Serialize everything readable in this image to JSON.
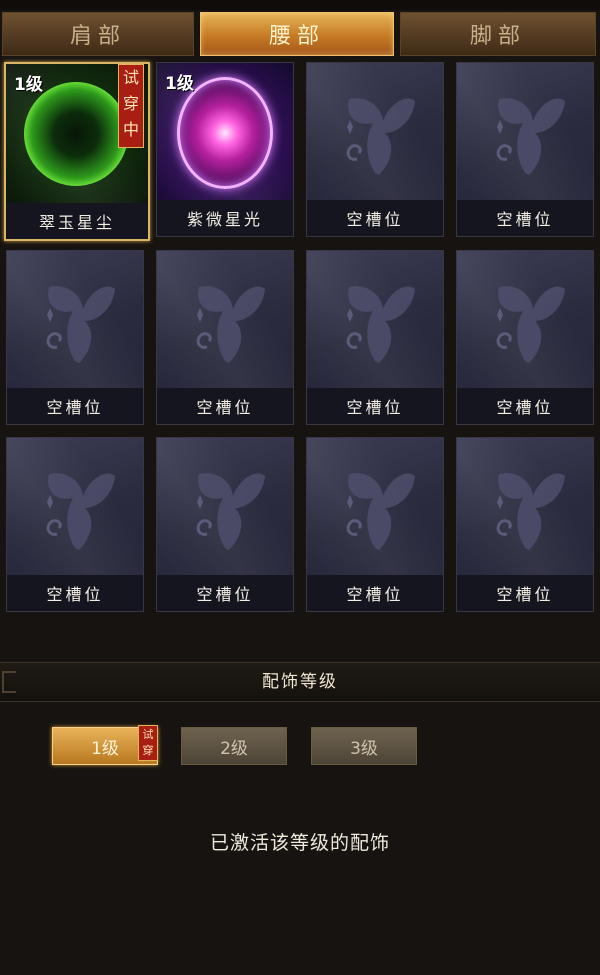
{
  "tabs": [
    {
      "label": "肩部",
      "active": false
    },
    {
      "label": "腰部",
      "active": true
    },
    {
      "label": "脚部",
      "active": false
    }
  ],
  "slots": [
    {
      "name": "翠玉星尘",
      "level": "1级",
      "trial": "试穿中",
      "icon": "green-orb-icon"
    },
    {
      "name": "紫微星光",
      "level": "1级",
      "icon": "purple-orb-icon"
    },
    {
      "name": "空槽位",
      "icon": "butterfly-icon"
    },
    {
      "name": "空槽位",
      "icon": "butterfly-icon"
    },
    {
      "name": "空槽位",
      "icon": "butterfly-icon"
    },
    {
      "name": "空槽位",
      "icon": "butterfly-icon"
    },
    {
      "name": "空槽位",
      "icon": "butterfly-icon"
    },
    {
      "name": "空槽位",
      "icon": "butterfly-icon"
    },
    {
      "name": "空槽位",
      "icon": "butterfly-icon"
    },
    {
      "name": "空槽位",
      "icon": "butterfly-icon"
    },
    {
      "name": "空槽位",
      "icon": "butterfly-icon"
    },
    {
      "name": "空槽位",
      "icon": "butterfly-icon"
    }
  ],
  "level_section": {
    "title": "配饰等级",
    "levels": [
      {
        "label": "1级",
        "active": true,
        "trial": "试穿"
      },
      {
        "label": "2级",
        "active": false
      },
      {
        "label": "3级",
        "active": false
      }
    ],
    "status": "已激活该等级的配饰"
  },
  "colors": {
    "accent_gold": "#e9b35a",
    "trial_red": "#a91e12",
    "background": "#171310"
  }
}
